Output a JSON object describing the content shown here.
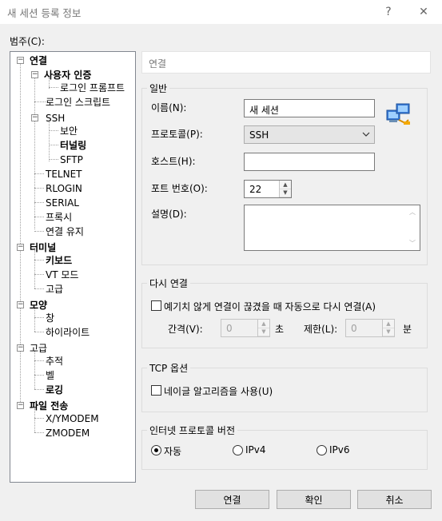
{
  "window": {
    "title": "새 세션 등록 정보",
    "help_glyph": "?",
    "close_glyph": "✕"
  },
  "category_label": "범주(C):",
  "tree": {
    "connection": "연결",
    "user_auth": "사용자 인증",
    "login_prompt": "로그인 프롬프트",
    "login_script": "로그인 스크립트",
    "ssh": "SSH",
    "security": "보안",
    "tunneling": "터널링",
    "sftp": "SFTP",
    "telnet": "TELNET",
    "rlogin": "RLOGIN",
    "serial": "SERIAL",
    "proxy": "프록시",
    "keepalive": "연결 유지",
    "terminal": "터미널",
    "keyboard": "키보드",
    "vt_mode": "VT 모드",
    "advanced_t": "고급",
    "appearance": "모양",
    "window": "창",
    "highlight": "하이라이트",
    "advanced": "고급",
    "trace": "추적",
    "bell": "벨",
    "logging": "로깅",
    "file_transfer": "파일 전송",
    "xymodem": "X/YMODEM",
    "zmodem": "ZMODEM"
  },
  "header": "연결",
  "general": {
    "title": "일반",
    "name_label": "이름(N):",
    "name_value": "새 세션",
    "protocol_label": "프로토콜(P):",
    "protocol_value": "SSH",
    "host_label": "호스트(H):",
    "host_value": "",
    "port_label": "포트 번호(O):",
    "port_value": "22",
    "desc_label": "설명(D):",
    "desc_value": ""
  },
  "reconnect": {
    "title": "다시 연결",
    "auto_label": "예기치 않게 연결이 끊겼을 때 자동으로 다시 연결(A)",
    "auto_checked": false,
    "interval_label": "간격(V):",
    "interval_value": "0",
    "interval_unit": "초",
    "limit_label": "제한(L):",
    "limit_value": "0",
    "limit_unit": "분"
  },
  "tcp": {
    "title": "TCP 옵션",
    "nagle_label": "네이글 알고리즘을 사용(U)",
    "nagle_checked": false
  },
  "ip_version": {
    "title": "인터넷 프로토콜 버전",
    "options": [
      "자동",
      "IPv4",
      "IPv6"
    ],
    "selected": "자동"
  },
  "buttons": {
    "connect": "연결",
    "ok": "확인",
    "cancel": "취소"
  }
}
